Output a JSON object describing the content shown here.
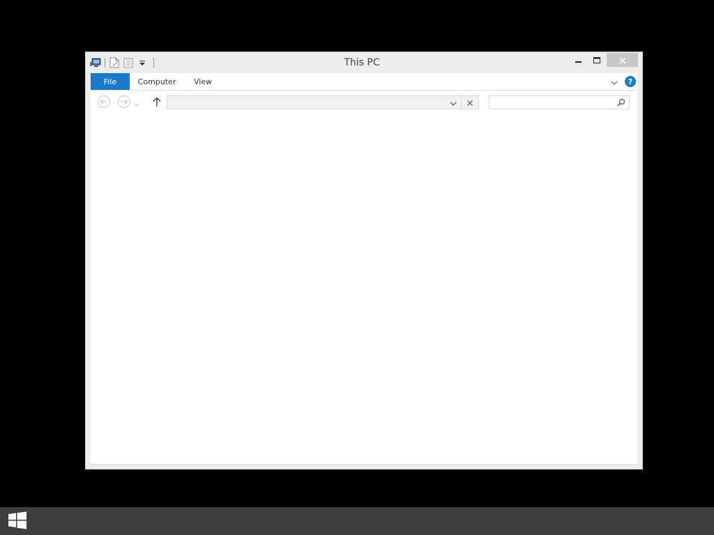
{
  "window": {
    "title": "This PC"
  },
  "quick_access": {
    "icons": [
      "properties-icon",
      "new-folder-icon",
      "customize-qat-icon"
    ]
  },
  "window_controls": {
    "icons": [
      "minimize-icon",
      "maximize-icon",
      "close-icon"
    ]
  },
  "ribbon": {
    "tabs": [
      {
        "label": "File"
      },
      {
        "label": "Computer"
      },
      {
        "label": "View"
      }
    ],
    "help_label": "?",
    "accent_color": "#1979ca"
  },
  "navbar": {
    "address_value": "",
    "search_placeholder": ""
  },
  "colors": {
    "desktop": "#000000",
    "taskbar": "#3d3d3d",
    "window_chrome": "#ececec",
    "close_button": "#c7c7c7"
  }
}
